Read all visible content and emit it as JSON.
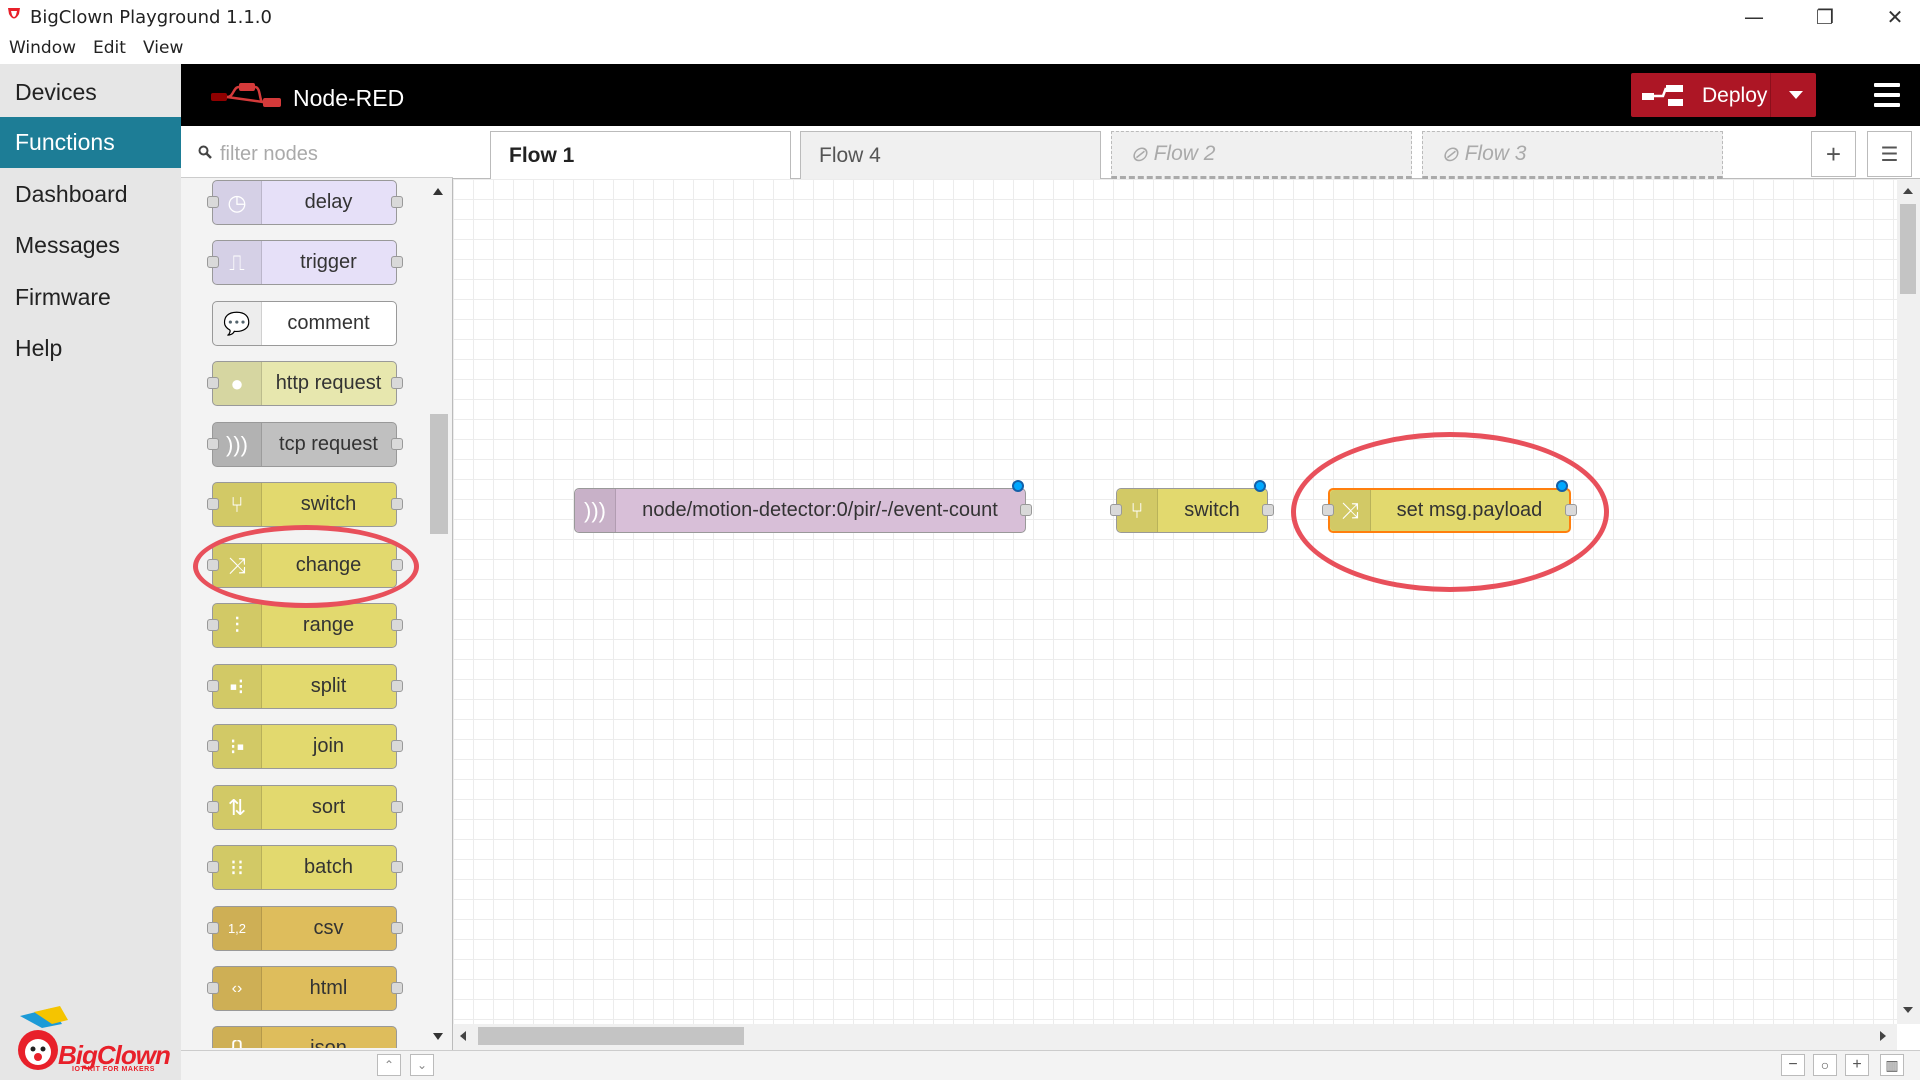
{
  "window": {
    "title": "BigClown Playground 1.1.0",
    "controls": {
      "minimize": "—",
      "restore": "❐",
      "close": "✕"
    }
  },
  "menubar": [
    "Window",
    "Edit",
    "View"
  ],
  "sidebar": {
    "items": [
      {
        "label": "Devices",
        "active": false
      },
      {
        "label": "Functions",
        "active": true
      },
      {
        "label": "Dashboard",
        "active": false
      },
      {
        "label": "Messages",
        "active": false
      },
      {
        "label": "Firmware",
        "active": false
      },
      {
        "label": "Help",
        "active": false
      }
    ],
    "logo_text": "BigClown",
    "logo_tagline": "IOT KIT FOR MAKERS"
  },
  "nodered": {
    "title": "Node-RED",
    "deploy_label": "Deploy"
  },
  "palette": {
    "filter_placeholder": "filter nodes",
    "nodes": [
      {
        "label": "delay",
        "color": "#e6e0f8",
        "icon": "clock-icon"
      },
      {
        "label": "trigger",
        "color": "#e6e0f8",
        "icon": "trigger-icon"
      },
      {
        "label": "comment",
        "color": "#ffffff",
        "icon": "comment-icon"
      },
      {
        "label": "http request",
        "color": "#e7e7ae",
        "icon": "globe-icon"
      },
      {
        "label": "tcp request",
        "color": "#c0c0c0",
        "icon": "wave-icon"
      },
      {
        "label": "switch",
        "color": "#e2d96e",
        "icon": "switch-icon"
      },
      {
        "label": "change",
        "color": "#e2d96e",
        "icon": "shuffle-icon"
      },
      {
        "label": "range",
        "color": "#e2d96e",
        "icon": "range-icon"
      },
      {
        "label": "split",
        "color": "#e2d96e",
        "icon": "split-icon"
      },
      {
        "label": "join",
        "color": "#e2d96e",
        "icon": "join-icon"
      },
      {
        "label": "sort",
        "color": "#e2d96e",
        "icon": "sort-icon"
      },
      {
        "label": "batch",
        "color": "#e2d96e",
        "icon": "batch-icon"
      },
      {
        "label": "csv",
        "color": "#debd5c",
        "icon": "csv-icon"
      },
      {
        "label": "html",
        "color": "#debd5c",
        "icon": "html-icon"
      },
      {
        "label": "json",
        "color": "#debd5c",
        "icon": "json-icon"
      }
    ]
  },
  "tabs": [
    {
      "label": "Flow 1",
      "active": true,
      "disabled": false
    },
    {
      "label": "Flow 4",
      "active": false,
      "disabled": false
    },
    {
      "label": "Flow 2",
      "active": false,
      "disabled": true
    },
    {
      "label": "Flow 3",
      "active": false,
      "disabled": true
    }
  ],
  "flow": {
    "nodes": [
      {
        "label": "node/motion-detector:0/pir/-/event-count",
        "color": "#d8bfd8",
        "icon": "wave-icon",
        "changed": true
      },
      {
        "label": "switch",
        "color": "#e2d96e",
        "icon": "switch-icon",
        "changed": true
      },
      {
        "label": "set msg.payload",
        "color": "#e2d96e",
        "icon": "shuffle-icon",
        "changed": true,
        "selected": true
      }
    ]
  },
  "colors": {
    "accent": "#1d7d96",
    "deploy": "#ad1625",
    "highlight": "#e8505b",
    "selected_outline": "#ff7f0e"
  }
}
